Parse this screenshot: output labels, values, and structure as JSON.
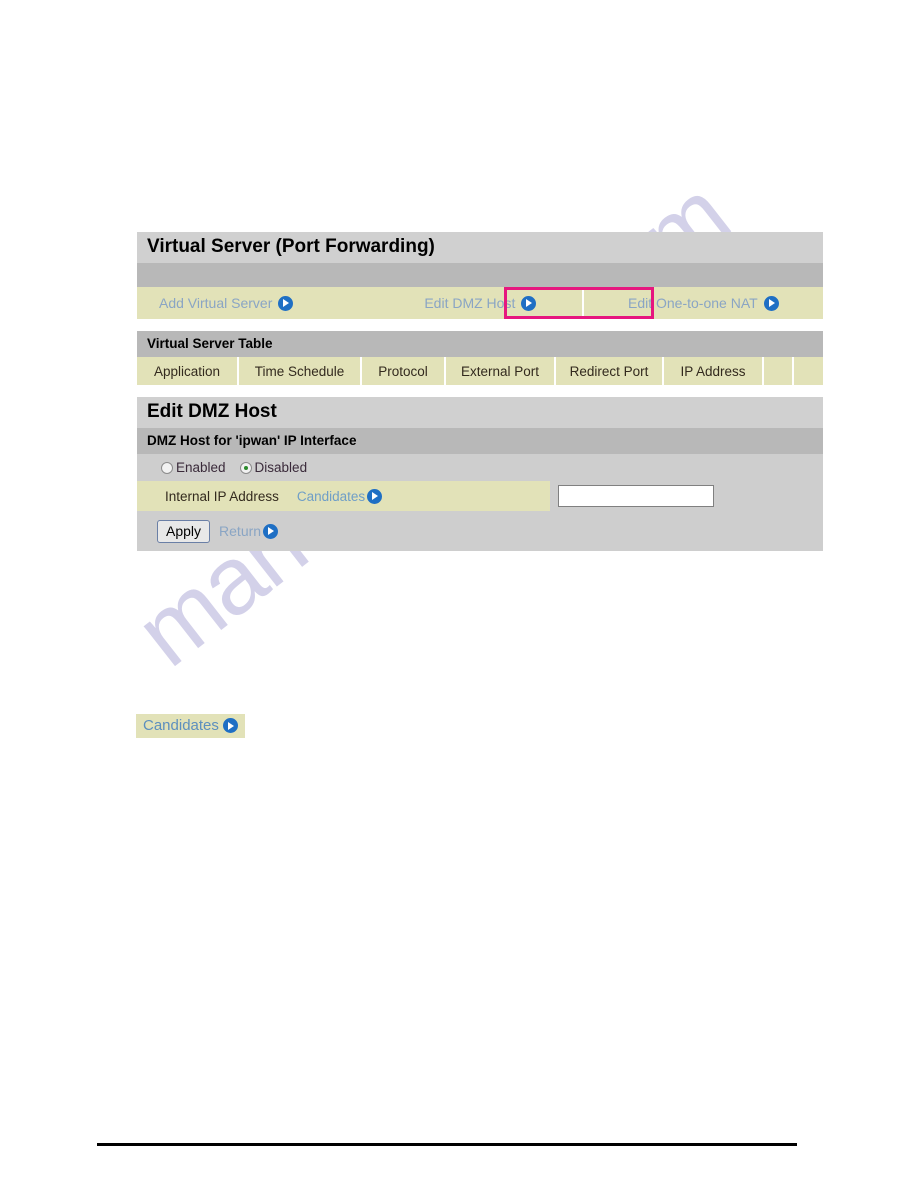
{
  "watermark": {
    "text": "manualshive.com"
  },
  "virtual_server_panel": {
    "title": "Virtual Server (Port Forwarding)",
    "nav": [
      {
        "label": "Add Virtual Server",
        "icon": "arrow-right-circle-icon",
        "highlighted": false
      },
      {
        "label": "Edit DMZ Host",
        "icon": "arrow-right-circle-icon",
        "highlighted": true
      },
      {
        "label": "Edit One-to-one NAT",
        "icon": "arrow-right-circle-icon",
        "highlighted": false
      }
    ],
    "highlight_color": "#e6177f"
  },
  "virtual_server_table": {
    "title": "Virtual Server Table",
    "columns": [
      "Application",
      "Time Schedule",
      "Protocol",
      "External Port",
      "Redirect Port",
      "IP Address",
      "",
      ""
    ],
    "rows": []
  },
  "edit_dmz_panel": {
    "title": "Edit DMZ Host",
    "subtitle": "DMZ Host for 'ipwan' IP Interface",
    "radio": {
      "enabled_label": "Enabled",
      "disabled_label": "Disabled",
      "selected": "Disabled"
    },
    "internal_ip": {
      "label": "Internal IP Address",
      "candidates_label": "Candidates",
      "candidates_icon": "arrow-right-circle-icon",
      "value": "",
      "placeholder": ""
    },
    "actions": {
      "apply_label": "Apply",
      "return_label": "Return",
      "return_icon": "arrow-right-circle-icon"
    }
  },
  "candidates_chip": {
    "label": "Candidates",
    "icon": "arrow-right-circle-icon"
  },
  "colors": {
    "panel_title_bg": "#d0d0d0",
    "band_bg": "#b8b8b8",
    "yellow_bg": "#e2e2b8",
    "gray_row_bg": "#cecece",
    "link_blue": "#8aa5c4",
    "highlight_pink": "#e6177f",
    "radio_dot_green": "#2b8a2b"
  }
}
